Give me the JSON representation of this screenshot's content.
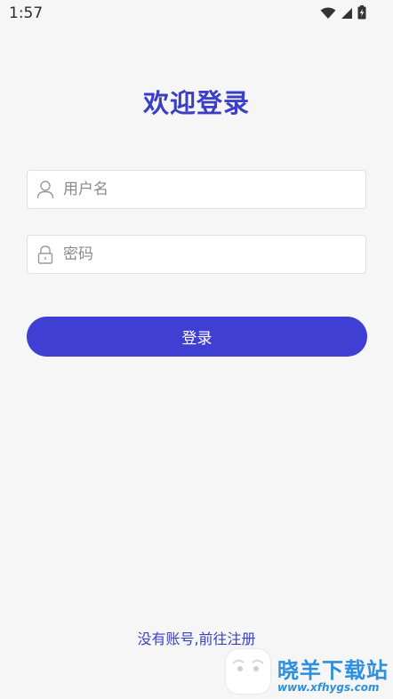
{
  "status_bar": {
    "time": "1:57",
    "icons": [
      "wifi-icon",
      "signal-icon",
      "battery-charging-icon"
    ]
  },
  "title": "欢迎登录",
  "form": {
    "username_placeholder": "用户名",
    "password_placeholder": "密码",
    "username_icon": "user-icon",
    "password_icon": "lock-icon",
    "login_label": "登录"
  },
  "register_link": "没有账号,前往注册",
  "watermark": {
    "title": "晓羊下载站",
    "url": "www.xfhygs.com"
  },
  "colors": {
    "accent": "#3f3fd3",
    "title": "#3b3fc8",
    "background": "#f6f6f6",
    "watermark": "#2e8fe0"
  }
}
